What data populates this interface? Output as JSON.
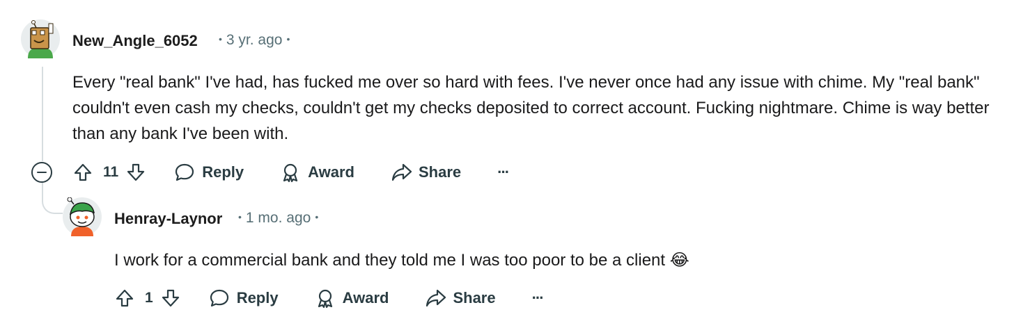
{
  "comments": [
    {
      "username": "New_Angle_6052",
      "time": "3 yr. ago",
      "body": "Every \"real bank\" I've had, has fucked me over so hard with fees. I've never once had any issue with chime. My \"real bank\" couldn't even cash my checks, couldn't get my checks deposited to correct account. Fucking nightmare. Chime is way better than any bank I've been with.",
      "votes": "11",
      "actions": {
        "reply": "Reply",
        "award": "Award",
        "share": "Share",
        "more": "···"
      }
    },
    {
      "username": "Henray-Laynor",
      "time": "1 mo. ago",
      "body": "I work for a commercial bank and they told me I was too poor to be a client",
      "emoji": "😂",
      "votes": "1",
      "actions": {
        "reply": "Reply",
        "award": "Award",
        "share": "Share",
        "more": "···"
      }
    }
  ],
  "colors": {
    "text": "#1a1a1b",
    "meta": "#576f76",
    "action": "#2a3c42",
    "thread": "#d7dde0",
    "accent_green": "#3aa34a",
    "accent_orange": "#f0612a"
  }
}
